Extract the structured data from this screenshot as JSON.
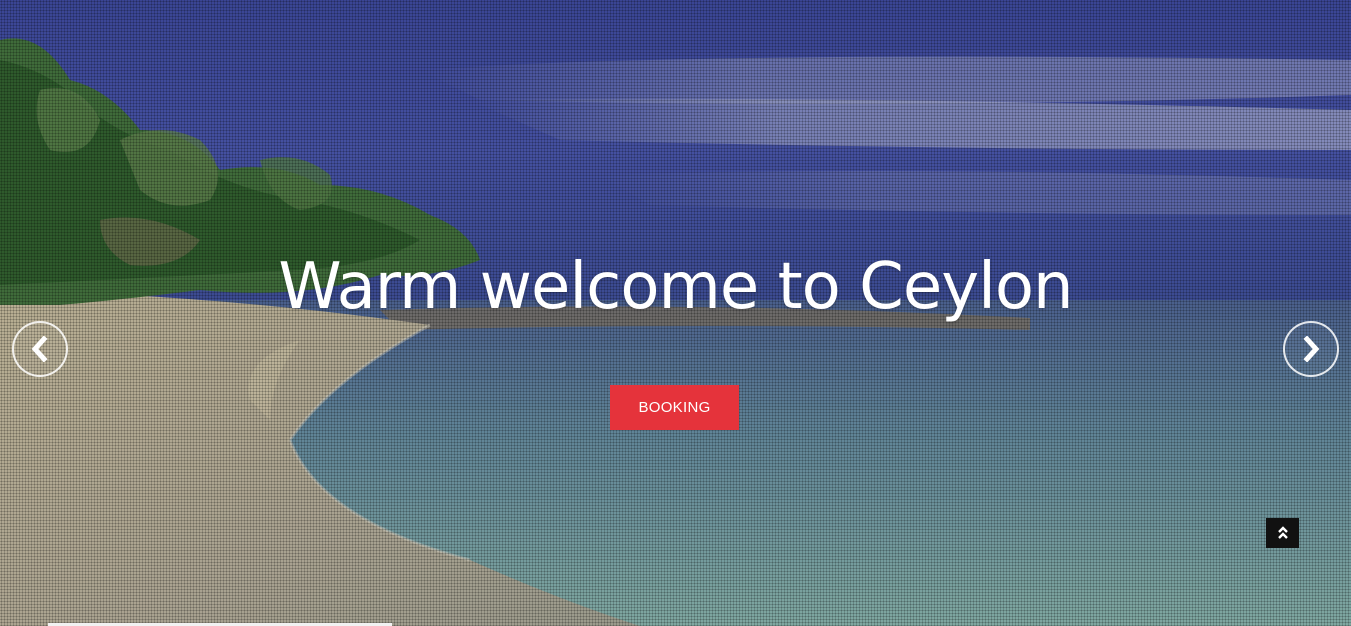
{
  "hero": {
    "headline": "Warm welcome to Ceylon",
    "booking_label": "BOOKING",
    "background_image": "tropical-beach-scene"
  },
  "carousel": {
    "prev_icon": "chevron-left-icon",
    "next_icon": "chevron-right-icon"
  },
  "scroll_top": {
    "icon": "double-chevron-up-icon"
  },
  "colors": {
    "accent": "#e5333b",
    "text": "#ffffff",
    "scroll_top_bg": "#111111"
  }
}
